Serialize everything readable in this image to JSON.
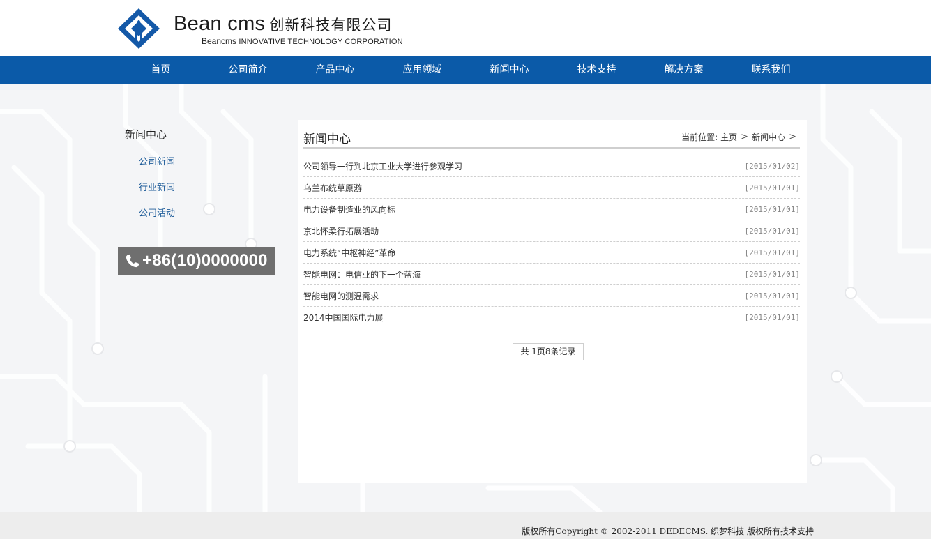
{
  "logo": {
    "brand": "Bean cms",
    "company_cn": "创新科技有限公司",
    "sub_brand": "Beancms",
    "sub_en": "INNOVATIVE TECHNOLOGY CORPORATION",
    "mark_color": "#1459a8"
  },
  "nav": {
    "color": "#0b5aa8",
    "items": [
      "首页",
      "公司简介",
      "产品中心",
      "应用领域",
      "新闻中心",
      "技术支持",
      "解决方案",
      "联系我们"
    ]
  },
  "sidebar": {
    "title": "新闻中心",
    "links": [
      "公司新闻",
      "行业新闻",
      "公司活动"
    ],
    "phone": "+86(10)0000000",
    "phone_icon": "phone-icon"
  },
  "main": {
    "title": "新闻中心",
    "breadcrumb": {
      "prefix": "当前位置:",
      "home": "主页",
      "current": "新闻中心",
      "separator": ">"
    },
    "news": [
      {
        "title": "公司领导一行到北京工业大学进行参观学习",
        "date": "[2015/01/02]"
      },
      {
        "title": "乌兰布统草原游",
        "date": "[2015/01/01]"
      },
      {
        "title": "电力设备制造业的风向标",
        "date": "[2015/01/01]"
      },
      {
        "title": "京北怀柔行拓展活动",
        "date": "[2015/01/01]"
      },
      {
        "title": "电力系统“中枢神经”革命",
        "date": "[2015/01/01]"
      },
      {
        "title": "智能电网：电信业的下一个蓝海",
        "date": "[2015/01/01]"
      },
      {
        "title": "智能电网的测温需求",
        "date": "[2015/01/01]"
      },
      {
        "title": "2014中国国际电力展",
        "date": "[2015/01/01]"
      }
    ],
    "pager": "共 1页8条记录"
  },
  "footer": {
    "copyright": "版权所有Copyright © 2002-2011 DEDECMS. 织梦科技 版权所有技术支持"
  }
}
